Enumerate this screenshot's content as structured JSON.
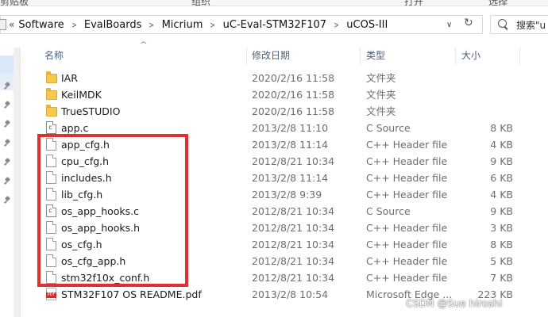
{
  "top_strip": {
    "labels": [
      "组织",
      "打开",
      "选择"
    ],
    "left_label": "剪贴板"
  },
  "breadcrumb": {
    "overflow": "«",
    "items": [
      "Software",
      "EvalBoards",
      "Micrium",
      "uC-Eval-STM32F107",
      "uCOS-III"
    ]
  },
  "search": {
    "placeholder": "搜索\"u"
  },
  "columns": {
    "name": "名称",
    "date": "修改日期",
    "type": "类型",
    "size": "大小"
  },
  "files": [
    {
      "name": "IAR",
      "date": "2020/2/16 11:58",
      "type": "文件夹",
      "size": "",
      "icon": "folder-icon"
    },
    {
      "name": "KeilMDK",
      "date": "2020/2/16 11:58",
      "type": "文件夹",
      "size": "",
      "icon": "folder-icon"
    },
    {
      "name": "TrueSTUDIO",
      "date": "2020/2/16 11:58",
      "type": "文件夹",
      "size": "",
      "icon": "folder-icon"
    },
    {
      "name": "app.c",
      "date": "2013/2/8 11:10",
      "type": "C Source",
      "size": "8 KB",
      "icon": "c-source-icon"
    },
    {
      "name": "app_cfg.h",
      "date": "2013/2/8 11:14",
      "type": "C++ Header file",
      "size": "4 KB",
      "icon": "header-file-icon"
    },
    {
      "name": "cpu_cfg.h",
      "date": "2012/8/21 10:34",
      "type": "C++ Header file",
      "size": "9 KB",
      "icon": "header-file-icon"
    },
    {
      "name": "includes.h",
      "date": "2013/2/8 11:14",
      "type": "C++ Header file",
      "size": "6 KB",
      "icon": "header-file-icon"
    },
    {
      "name": "lib_cfg.h",
      "date": "2013/2/8 9:39",
      "type": "C++ Header file",
      "size": "4 KB",
      "icon": "header-file-icon"
    },
    {
      "name": "os_app_hooks.c",
      "date": "2012/8/21 10:34",
      "type": "C Source",
      "size": "9 KB",
      "icon": "c-source-icon"
    },
    {
      "name": "os_app_hooks.h",
      "date": "2012/8/21 10:34",
      "type": "C++ Header file",
      "size": "3 KB",
      "icon": "header-file-icon"
    },
    {
      "name": "os_cfg.h",
      "date": "2012/8/21 10:34",
      "type": "C++ Header file",
      "size": "8 KB",
      "icon": "header-file-icon"
    },
    {
      "name": "os_cfg_app.h",
      "date": "2012/8/21 10:34",
      "type": "C++ Header file",
      "size": "5 KB",
      "icon": "header-file-icon"
    },
    {
      "name": "stm32f10x_conf.h",
      "date": "2012/8/21 10:34",
      "type": "C++ Header file",
      "size": "7 KB",
      "icon": "header-file-icon"
    },
    {
      "name": "STM32F107 OS README.pdf",
      "date": "2013/2/8 10:54",
      "type": "Microsoft Edge ...",
      "size": "223 KB",
      "icon": "pdf-icon"
    }
  ],
  "watermark": "CSDN @Sue hiroshi",
  "colors": {
    "highlight": "#e03131",
    "folder": "#f6c94e",
    "pdf": "#d62b22"
  }
}
